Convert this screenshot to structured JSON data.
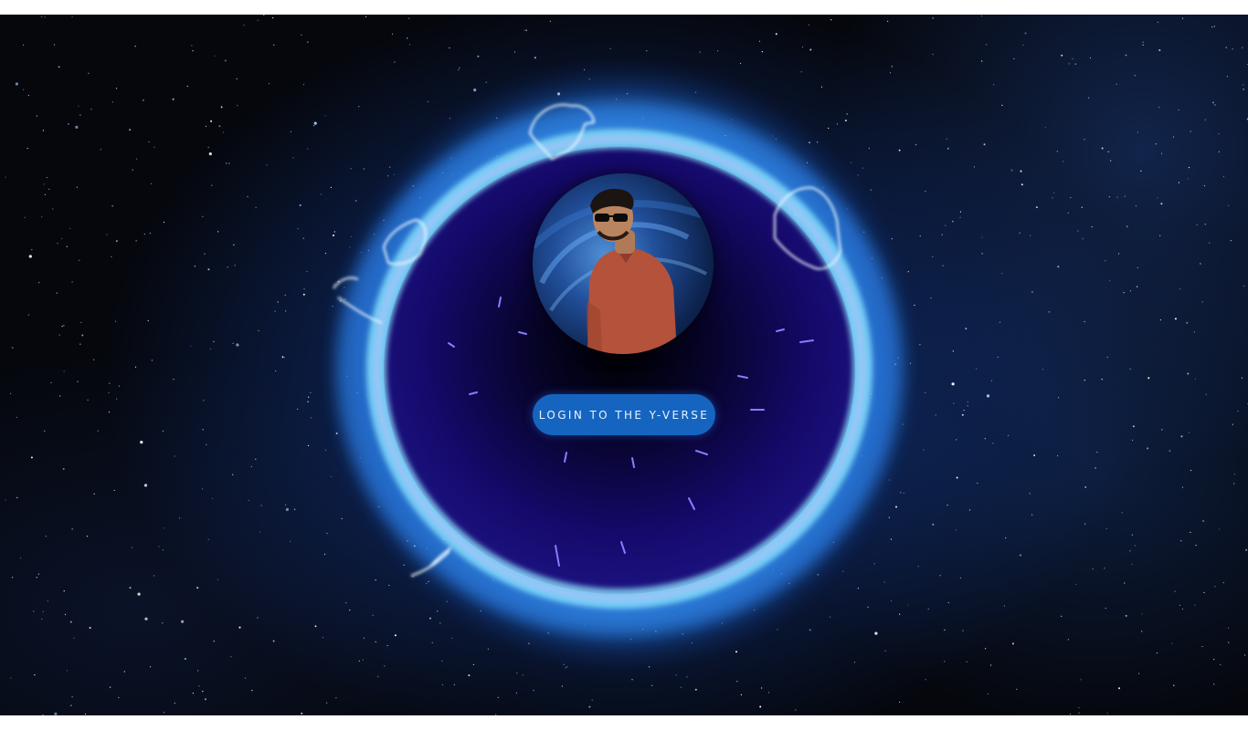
{
  "login": {
    "button_label": "LOGIN TO THE Y-VERSE"
  },
  "profile": {
    "avatar_icon": "profile-photo"
  },
  "background": {
    "scene": "starfield with glowing blue energy portal",
    "colors": {
      "space": "#05070d",
      "portal_glow": "#3fa9ff",
      "portal_ring": "#7fe3ff",
      "portal_inner": "#120a55",
      "button": "#1565c0"
    }
  }
}
